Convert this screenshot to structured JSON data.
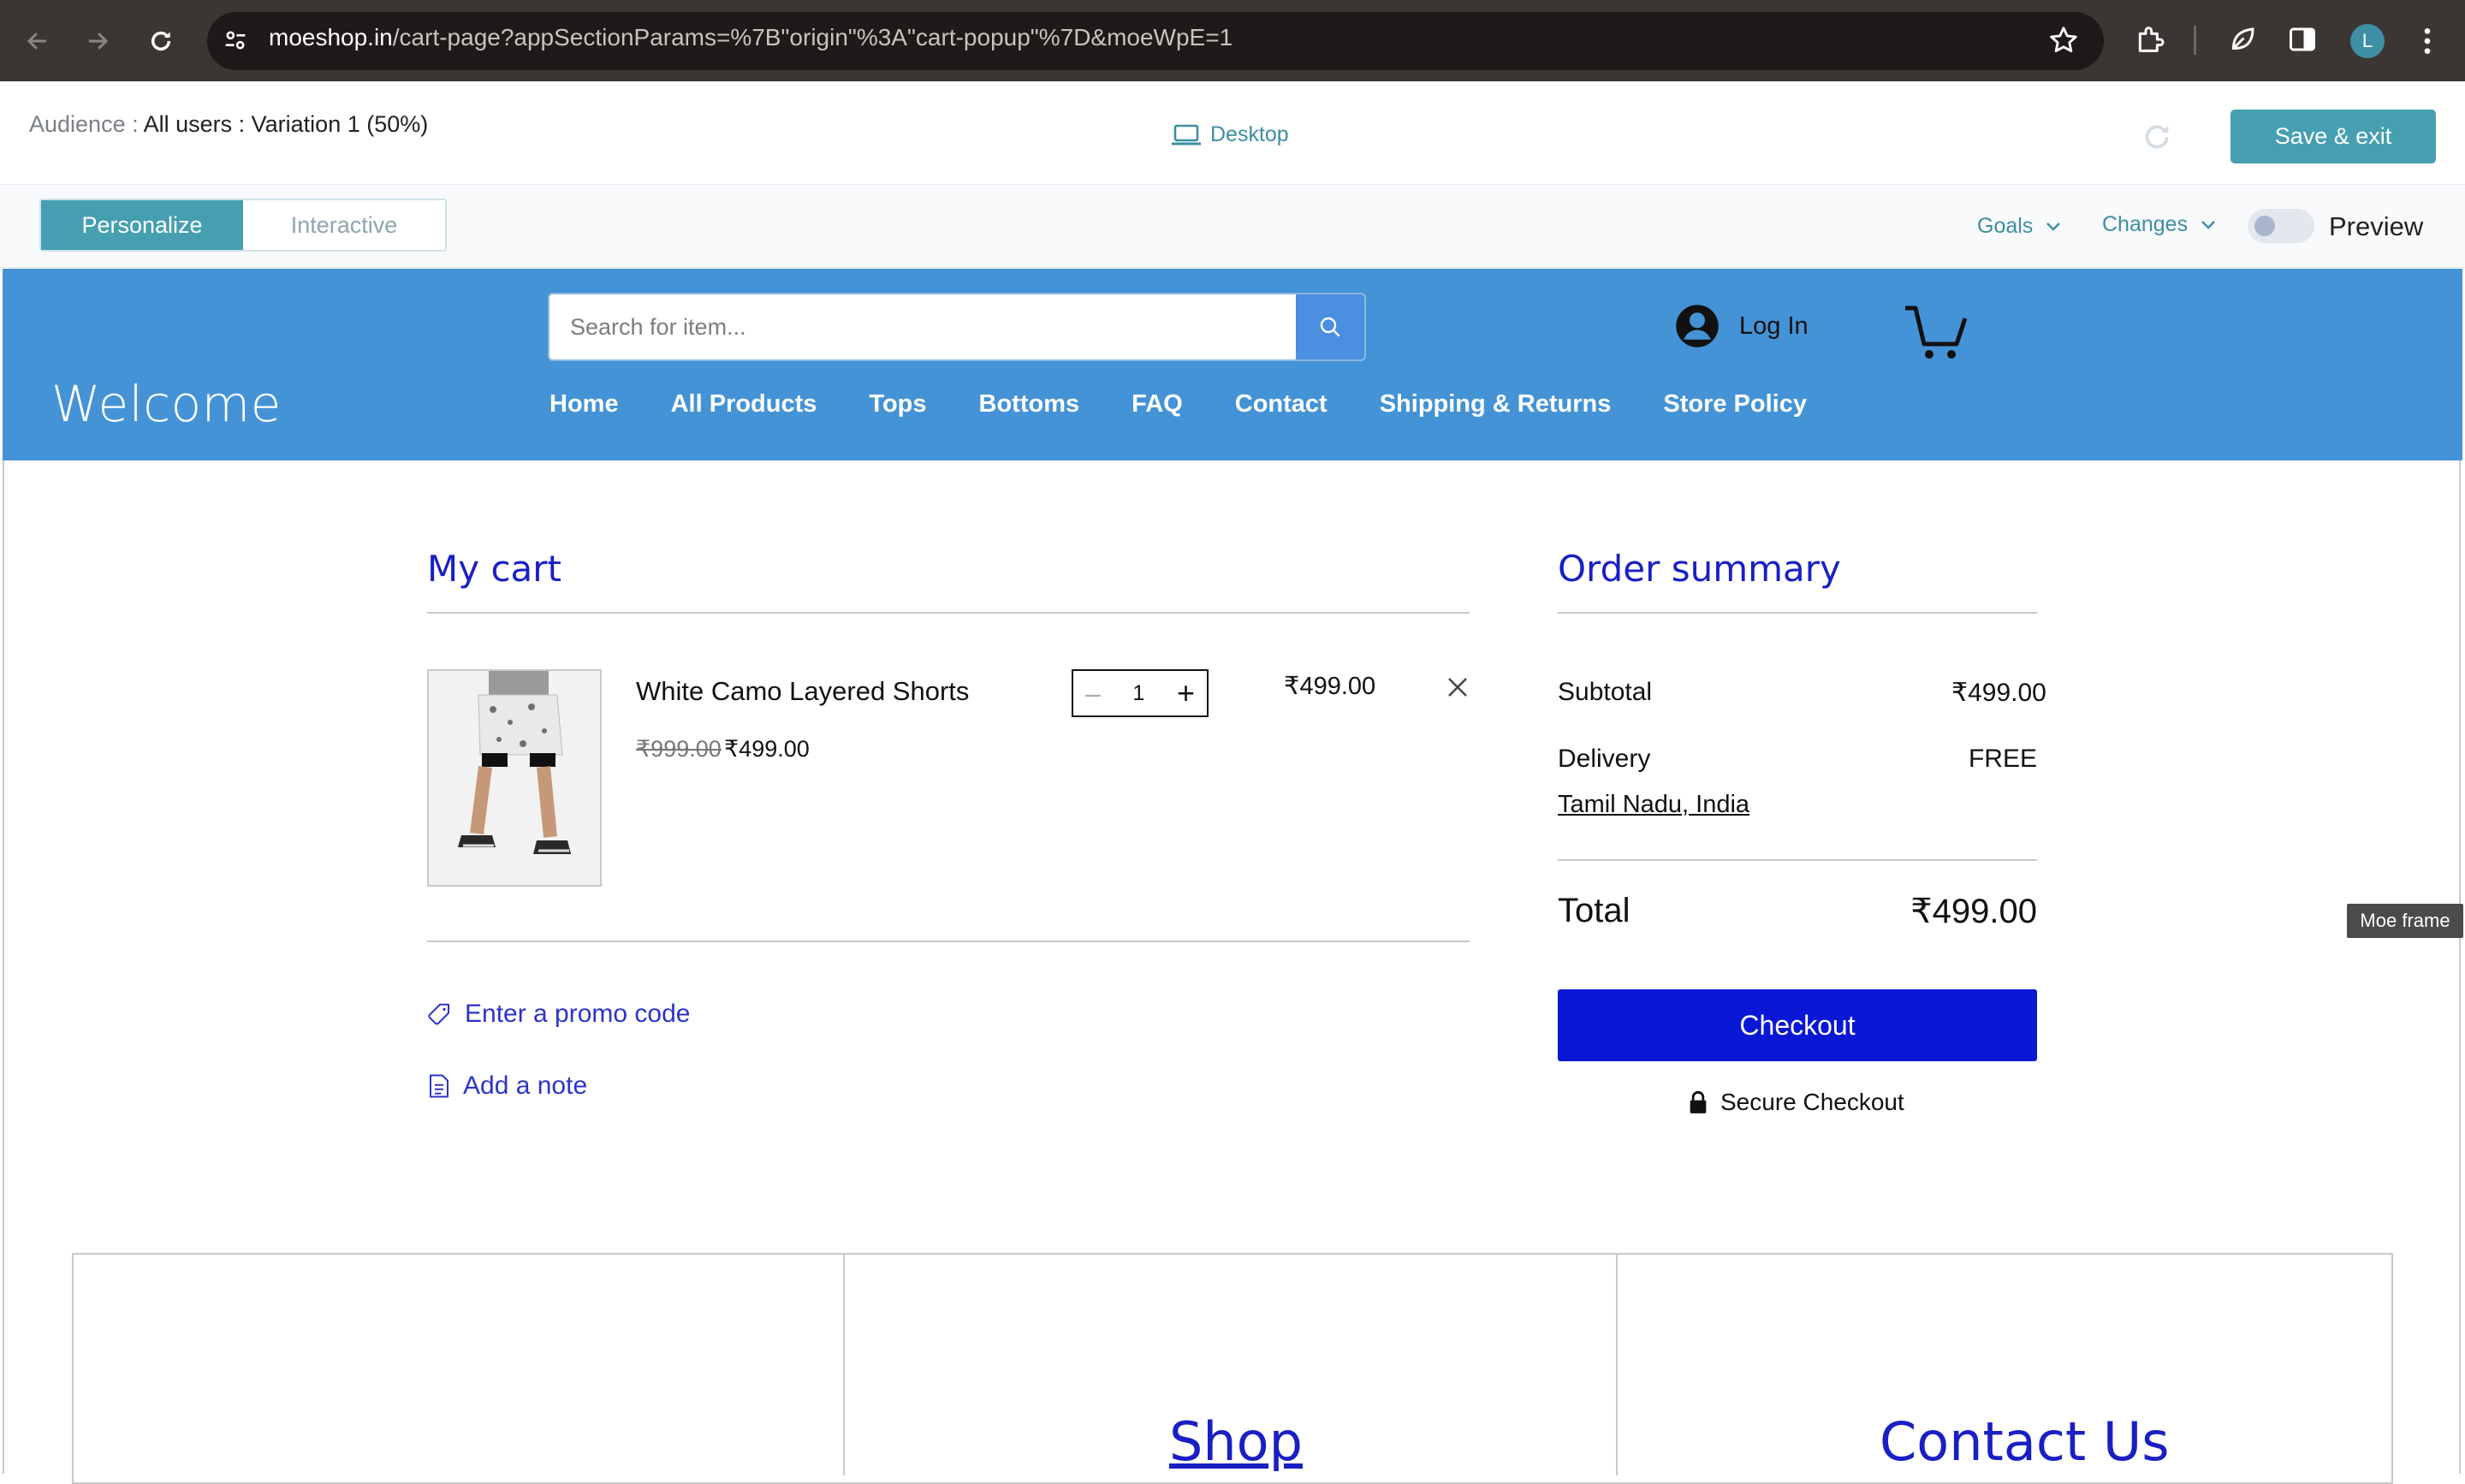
{
  "browser": {
    "url_host": "moeshop.in",
    "url_path": "/cart-page?appSectionParams=%7B\"origin\"%3A\"cart-popup\"%7D&moeWpE=1",
    "profile_initial": "L",
    "icons": [
      "back-arrow-icon",
      "forward-arrow-icon",
      "reload-icon",
      "site-settings-icon",
      "star-icon",
      "extensions-icon",
      "leaf-icon",
      "side-panel-icon",
      "kebab-menu-icon"
    ]
  },
  "editor": {
    "audience_label": "Audience :",
    "audience_value": "All users : Variation 1 (50%)",
    "device_label": "Desktop",
    "save_exit_label": "Save & exit",
    "tabs": {
      "personalize": "Personalize",
      "interactive": "Interactive"
    },
    "goals_label": "Goals",
    "changes_label": "Changes",
    "preview_label": "Preview",
    "preview_on": false,
    "accent_color": "#469fb1"
  },
  "site": {
    "brand": "Welcome",
    "search_placeholder": "Search for item...",
    "login_label": "Log In",
    "nav": [
      "Home",
      "All Products",
      "Tops",
      "Bottoms",
      "FAQ",
      "Contact",
      "Shipping & Returns",
      "Store Policy"
    ],
    "header_color": "#4493d6"
  },
  "cart": {
    "title": "My cart",
    "item": {
      "name": "White Camo Layered Shorts",
      "price_original": "₹999.00",
      "price_sale": "₹499.00",
      "quantity": "1",
      "line_total": "₹499.00"
    },
    "promo_label": "Enter a promo code",
    "note_label": "Add a note"
  },
  "summary": {
    "title": "Order summary",
    "subtotal_label": "Subtotal",
    "subtotal_value": "₹499.00",
    "delivery_label": "Delivery",
    "delivery_value": "FREE",
    "location": "Tamil Nadu, India",
    "total_label": "Total",
    "total_value": "₹499.00",
    "checkout_label": "Checkout",
    "secure_label": "Secure Checkout",
    "checkout_color": "#0a17d4"
  },
  "overlay": {
    "moe_frame_label": "Moe frame"
  },
  "footer": {
    "shop_label": "Shop",
    "contact_label": "Contact Us"
  }
}
